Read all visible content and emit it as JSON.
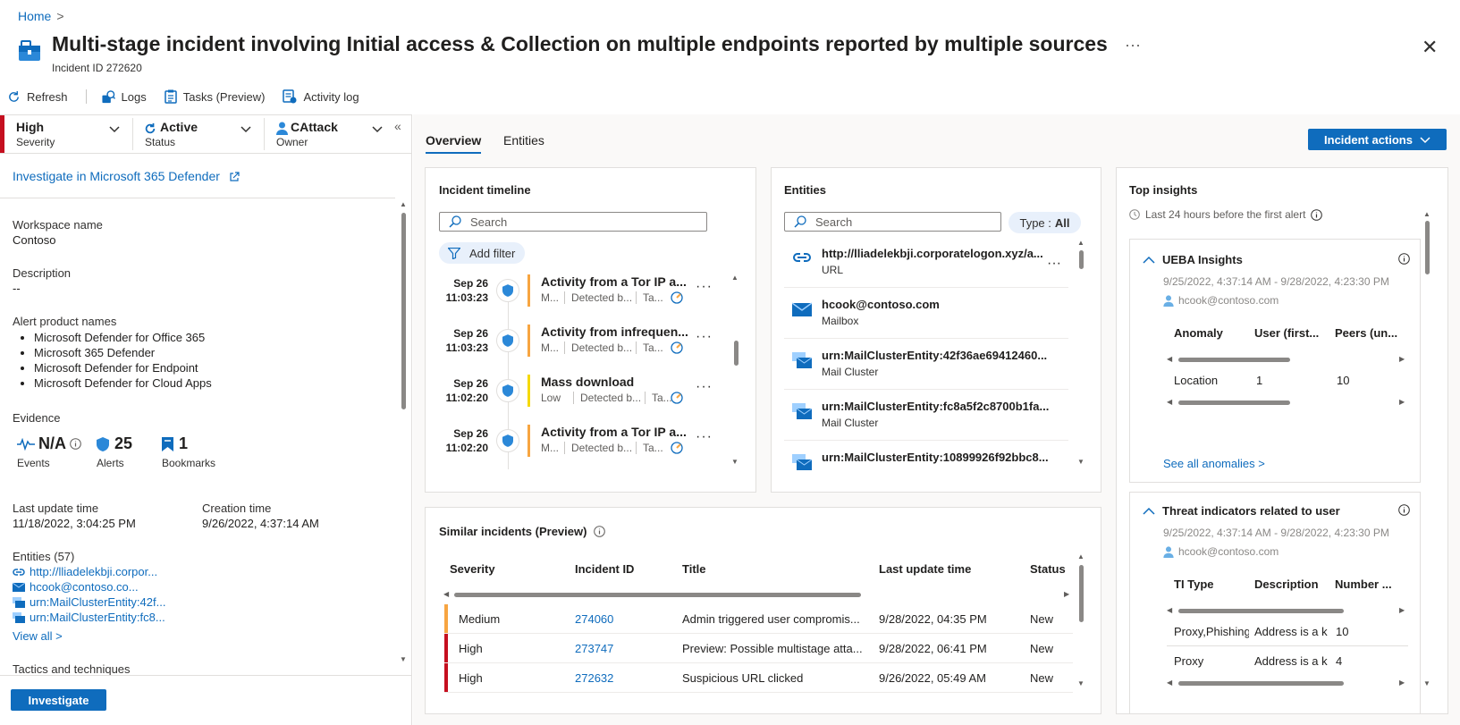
{
  "breadcrumb": {
    "home": "Home",
    "separator": ">"
  },
  "header": {
    "title": "Multi-stage incident involving Initial access & Collection on multiple endpoints reported by multiple sources",
    "incident_id": "Incident ID 272620",
    "more": "···",
    "close": "✕"
  },
  "toolbar": {
    "refresh": "Refresh",
    "logs": "Logs",
    "tasks": "Tasks (Preview)",
    "activity_log": "Activity log"
  },
  "status_bar": {
    "severity": {
      "value": "High",
      "label": "Severity"
    },
    "status": {
      "value": "Active",
      "label": "Status"
    },
    "owner": {
      "value": "CAttack",
      "label": "Owner"
    },
    "collapse": "«"
  },
  "left": {
    "investigate_link": "Investigate in Microsoft 365 Defender",
    "workspace_label": "Workspace name",
    "workspace_value": "Contoso",
    "description_label": "Description",
    "description_value": "--",
    "products_label": "Alert product names",
    "products": [
      "Microsoft Defender for Office 365",
      "Microsoft 365 Defender",
      "Microsoft Defender for Endpoint",
      "Microsoft Defender for Cloud Apps"
    ],
    "evidence_label": "Evidence",
    "evidence": {
      "events_value": "N/A",
      "events_label": "Events",
      "alerts_value": "25",
      "alerts_label": "Alerts",
      "bookmarks_value": "1",
      "bookmarks_label": "Bookmarks"
    },
    "last_update_label": "Last update time",
    "last_update_value": "11/18/2022, 3:04:25 PM",
    "creation_label": "Creation time",
    "creation_value": "9/26/2022, 4:37:14 AM",
    "entities_label": "Entities (57)",
    "entities": [
      "http://lliadelekbji.corpor...",
      "hcook@contoso.co...",
      "urn:MailClusterEntity:42f...",
      "urn:MailClusterEntity:fc8..."
    ],
    "view_all": "View all >",
    "tactics_label": "Tactics and techniques",
    "investigate_button": "Investigate"
  },
  "tabs": {
    "overview": "Overview",
    "entities": "Entities"
  },
  "incident_actions": "Incident actions",
  "timeline": {
    "title": "Incident timeline",
    "search_placeholder": "Search",
    "add_filter": "Add filter",
    "items": [
      {
        "date": "Sep 26",
        "time": "11:03:23",
        "title": "Activity from a Tor IP a...",
        "sev": "M...",
        "detected": "Detected b...",
        "tactic": "Ta...",
        "color": "#f7a541"
      },
      {
        "date": "Sep 26",
        "time": "11:03:23",
        "title": "Activity from infrequen...",
        "sev": "M...",
        "detected": "Detected b...",
        "tactic": "Ta...",
        "color": "#f7a541"
      },
      {
        "date": "Sep 26",
        "time": "11:02:20",
        "title": "Mass download",
        "sev": "Low",
        "detected": "Detected b...",
        "tactic": "Ta...",
        "color": "#f5d90a"
      },
      {
        "date": "Sep 26",
        "time": "11:02:20",
        "title": "Activity from a Tor IP a...",
        "sev": "M...",
        "detected": "Detected b...",
        "tactic": "Ta...",
        "color": "#f7a541"
      }
    ]
  },
  "entities_card": {
    "title": "Entities",
    "search_placeholder": "Search",
    "type_filter_label": "Type :",
    "type_filter_value": "All",
    "items": [
      {
        "name": "http://lliadelekbji.corporatelogon.xyz/a...",
        "type": "URL",
        "icon": "link-icon"
      },
      {
        "name": "hcook@contoso.com",
        "type": "Mailbox",
        "icon": "mailbox-icon"
      },
      {
        "name": "urn:MailClusterEntity:42f36ae69412460...",
        "type": "Mail Cluster",
        "icon": "mail-cluster-icon"
      },
      {
        "name": "urn:MailClusterEntity:fc8a5f2c8700b1fa...",
        "type": "Mail Cluster",
        "icon": "mail-cluster-icon"
      },
      {
        "name": "urn:MailClusterEntity:10899926f92bbc8...",
        "type": "",
        "icon": "mail-cluster-icon"
      }
    ]
  },
  "similar": {
    "title": "Similar incidents (Preview)",
    "columns": [
      "Severity",
      "Incident ID",
      "Title",
      "Last update time",
      "Status"
    ],
    "rows": [
      {
        "severity": "Medium",
        "id": "274060",
        "title": "Admin triggered user compromis...",
        "updated": "9/28/2022, 04:35 PM",
        "status": "New",
        "color": "#f7a541"
      },
      {
        "severity": "High",
        "id": "273747",
        "title": "Preview: Possible multistage atta...",
        "updated": "9/28/2022, 06:41 PM",
        "status": "New",
        "color": "#c50f1f"
      },
      {
        "severity": "High",
        "id": "272632",
        "title": "Suspicious URL clicked",
        "updated": "9/26/2022, 05:49 AM",
        "status": "New",
        "color": "#c50f1f"
      }
    ]
  },
  "insights": {
    "title": "Top insights",
    "subtitle": "Last 24 hours before the first alert",
    "ueba": {
      "title": "UEBA Insights",
      "range": "9/25/2022, 4:37:14 AM - 9/28/2022, 4:23:30 PM",
      "user": "hcook@contoso.com",
      "columns": [
        "Anomaly",
        "User (first...",
        "Peers (un..."
      ],
      "row": [
        "Location",
        "1",
        "10"
      ],
      "see_all": "See all anomalies >"
    },
    "ti": {
      "title": "Threat indicators related to user",
      "range": "9/25/2022, 4:37:14 AM - 9/28/2022, 4:23:30 PM",
      "user": "hcook@contoso.com",
      "columns": [
        "TI Type",
        "Description",
        "Number ..."
      ],
      "rows": [
        [
          "Proxy,Phishing",
          "Address is a k",
          "10"
        ],
        [
          "Proxy",
          "Address is a k",
          "4"
        ]
      ]
    }
  },
  "colors": {
    "accent": "#0f6cbd",
    "high": "#c50f1f",
    "medium": "#f7a541",
    "low": "#f5d90a"
  }
}
